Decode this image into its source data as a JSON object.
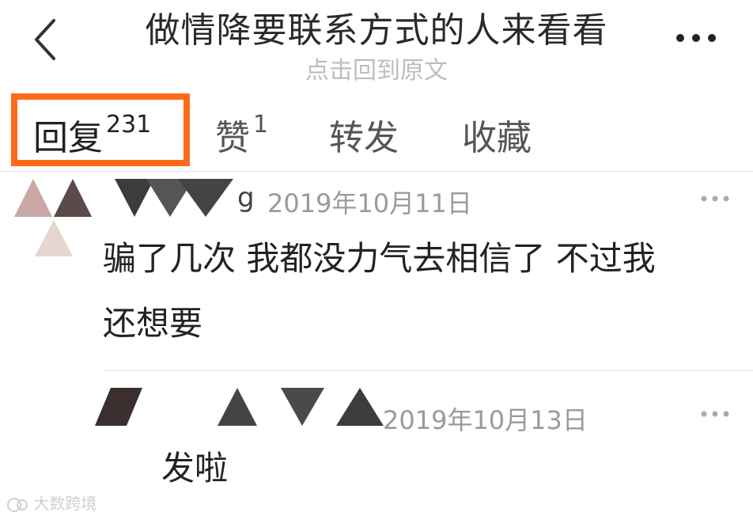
{
  "header": {
    "title": "做情降要联系方式的人来看看",
    "subtitle": "点击回到原文"
  },
  "tabs": [
    {
      "label": "回复",
      "count": "231"
    },
    {
      "label": "赞",
      "count": "1"
    },
    {
      "label": "转发",
      "count": ""
    },
    {
      "label": "收藏",
      "count": ""
    }
  ],
  "comments": [
    {
      "username": "g",
      "date": "2019年10月11日",
      "text_line1": "骗了几次 我都没力气去相信了 不过我",
      "text_line2": "还想要"
    },
    {
      "date": "2019年10月13日",
      "text": "发啦"
    }
  ],
  "watermark": "大数跨境",
  "colors": {
    "highlight": "#ff6a1a"
  },
  "icons": {
    "back": "chevron-left-icon",
    "more": "more-horizontal-icon",
    "comment_more": "ellipsis-icon"
  }
}
